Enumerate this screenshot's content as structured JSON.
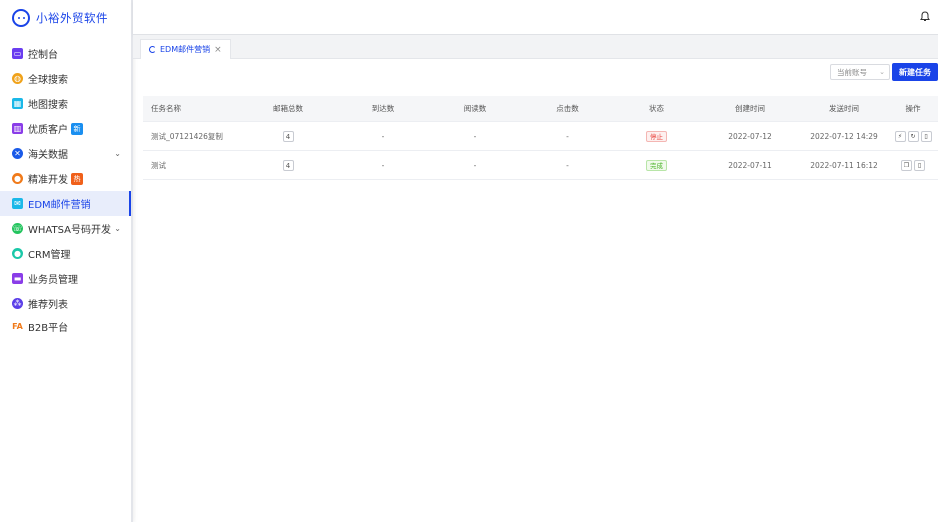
{
  "brand": {
    "name": "小裕外贸软件"
  },
  "sidebar": {
    "items": [
      {
        "label": "控制台",
        "icon": "monitor-icon",
        "color": "#6a3df0"
      },
      {
        "label": "全球搜索",
        "icon": "globe-icon",
        "color": "#f0a21a"
      },
      {
        "label": "地图搜索",
        "icon": "map-icon",
        "color": "#1ab8e8"
      },
      {
        "label": "优质客户",
        "icon": "book-icon",
        "color": "#8a3de8",
        "badge": "新"
      },
      {
        "label": "海关数据",
        "icon": "compass-icon",
        "color": "#1a5ae8",
        "expandable": true
      },
      {
        "label": "精准开发",
        "icon": "people-icon",
        "color": "#f07a1a",
        "badge": "热"
      },
      {
        "label": "EDM邮件营销",
        "icon": "mail-icon",
        "color": "#1ab8e8",
        "active": true
      },
      {
        "label": "WHATSA号码开发",
        "icon": "whatsapp-icon",
        "color": "#23c45e",
        "expandable": true
      },
      {
        "label": "CRM管理",
        "icon": "user-icon",
        "color": "#1ac8a8"
      },
      {
        "label": "业务员管理",
        "icon": "briefcase-icon",
        "color": "#8a3de8"
      },
      {
        "label": "推荐列表",
        "icon": "network-icon",
        "color": "#5a3de8"
      },
      {
        "label": "B2B平台",
        "icon": "fa-logo-icon",
        "color": "#f07a1a"
      }
    ]
  },
  "tabs": [
    {
      "label": "EDM邮件营销",
      "close": "×"
    }
  ],
  "toolbar": {
    "account_placeholder": "当前账号",
    "new_task_label": "新建任务"
  },
  "table": {
    "headers": [
      "任务名称",
      "邮箱总数",
      "到达数",
      "阅读数",
      "点击数",
      "状态",
      "创建时间",
      "发送时间",
      "操作"
    ],
    "rows": [
      {
        "name": "测试_07121426复制",
        "total": "4",
        "delivered": "-",
        "read": "-",
        "clicks": "-",
        "status": "停止",
        "status_type": "stop",
        "created": "2022-07-12",
        "sent": "2022-07-12 14:29",
        "ops": [
          "play-icon",
          "refresh-icon",
          "delete-icon"
        ]
      },
      {
        "name": "测试",
        "total": "4",
        "delivered": "-",
        "read": "-",
        "clicks": "-",
        "status": "完成",
        "status_type": "done",
        "created": "2022-07-11",
        "sent": "2022-07-11 16:12",
        "ops": [
          "copy-icon",
          "delete-icon"
        ]
      }
    ]
  },
  "colors": {
    "primary": "#1a44e8",
    "stop": "#e8403a",
    "done": "#4bb42a"
  }
}
